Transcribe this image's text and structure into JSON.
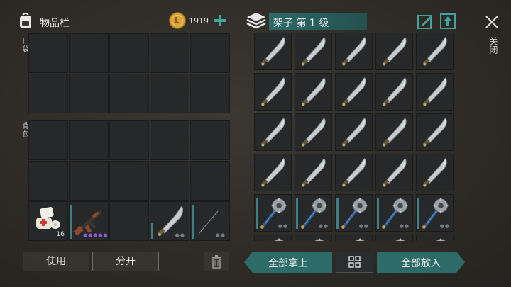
{
  "inventory": {
    "title": "物品栏",
    "coins": "1919",
    "pocket_label": "口袋",
    "backpack_label": "背包",
    "use_button": "使用",
    "split_button": "分开",
    "medkit_count": "16"
  },
  "shelf": {
    "title": "架子 第 1 级",
    "take_all_button": "全部拿上",
    "put_all_button": "全部放入"
  },
  "close_label": "关闭",
  "colors": {
    "teal": "#2c6b68",
    "coin": "#d8a23a",
    "rarity_purple": "#8a5ad0"
  },
  "shelf_items": {
    "rows": [
      [
        "machete",
        "machete",
        "machete",
        "machete",
        "machete"
      ],
      [
        "machete",
        "machete",
        "machete",
        "machete",
        "machete"
      ],
      [
        "machete",
        "machete",
        "machete",
        "machete",
        "machete"
      ],
      [
        "machete",
        "machete",
        "machete",
        "machete",
        "machete"
      ],
      [
        "saw-mace",
        "saw-mace",
        "saw-mace",
        "saw-mace",
        "saw-mace"
      ]
    ]
  }
}
